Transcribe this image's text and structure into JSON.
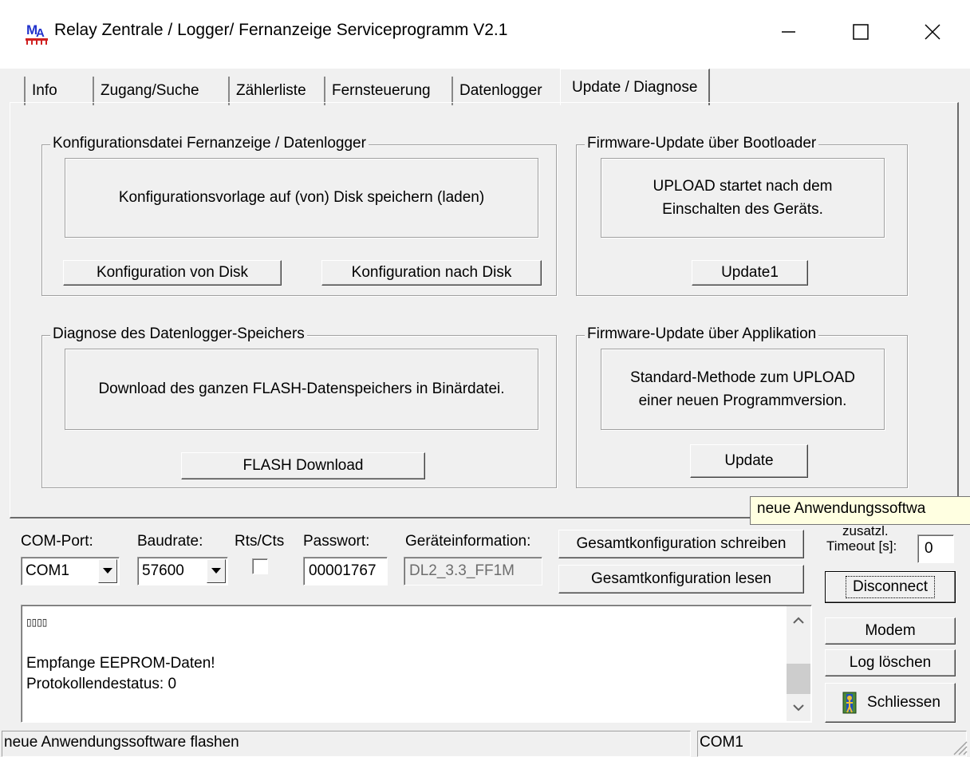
{
  "window": {
    "title": "Relay Zentrale / Logger/ Fernanzeige Serviceprogramm  V2.1",
    "minimize_icon": "minimize-icon",
    "maximize_icon": "maximize-icon",
    "close_icon": "close-icon"
  },
  "tabs": [
    {
      "label": "Info"
    },
    {
      "label": "Zugang/Suche"
    },
    {
      "label": "Zählerliste"
    },
    {
      "label": "Fernsteuerung"
    },
    {
      "label": "Datenlogger"
    },
    {
      "label": "Update / Diagnose",
      "active": true
    }
  ],
  "groups": {
    "config_file": {
      "title": "Konfigurationsdatei Fernanzeige / Datenlogger",
      "info": "Konfigurationsvorlage auf (von) Disk speichern (laden)",
      "button_from_disk": "Konfiguration von Disk",
      "button_to_disk": "Konfiguration nach Disk"
    },
    "bootloader": {
      "title": "Firmware-Update über Bootloader",
      "info_line1": "UPLOAD startet nach dem",
      "info_line2": "Einschalten des Geräts.",
      "button": "Update1"
    },
    "diagnose": {
      "title": "Diagnose des Datenlogger-Speichers",
      "info": "Download des ganzen FLASH-Datenspeichers in Binärdatei.",
      "button": "FLASH Download"
    },
    "application": {
      "title": "Firmware-Update über Applikation",
      "info_line1": "Standard-Methode zum UPLOAD",
      "info_line2": "einer neuen Programmversion.",
      "button": "Update"
    }
  },
  "tooltip": "neue Anwendungssoftwa",
  "connection": {
    "com_port_label": "COM-Port:",
    "com_port_value": "COM1",
    "baudrate_label": "Baudrate:",
    "baudrate_value": "57600",
    "rtscts_label": "Rts/Cts",
    "rtscts_checked": false,
    "password_label": "Passwort:",
    "password_value": "00001767",
    "device_info_label": "Geräteinformation:",
    "device_info_value": "DL2_3.3_FF1M",
    "write_all_button": "Gesamtkonfiguration schreiben",
    "read_all_button": "Gesamtkonfiguration lesen",
    "timeout_label_line1": "zusatzl.",
    "timeout_label_line2": "Timeout [s]:",
    "timeout_value": "0",
    "disconnect_button": "Disconnect"
  },
  "log": {
    "line1": "▯▯▯▯",
    "line2": "",
    "line3": "Empfange EEPROM-Daten!",
    "line4": "Protokollendestatus: 0"
  },
  "side_buttons": {
    "modem": "Modem",
    "clear_log": "Log löschen",
    "close": "Schliessen"
  },
  "status_bar": {
    "left": "neue Anwendungssoftware flashen",
    "right": "COM1"
  }
}
